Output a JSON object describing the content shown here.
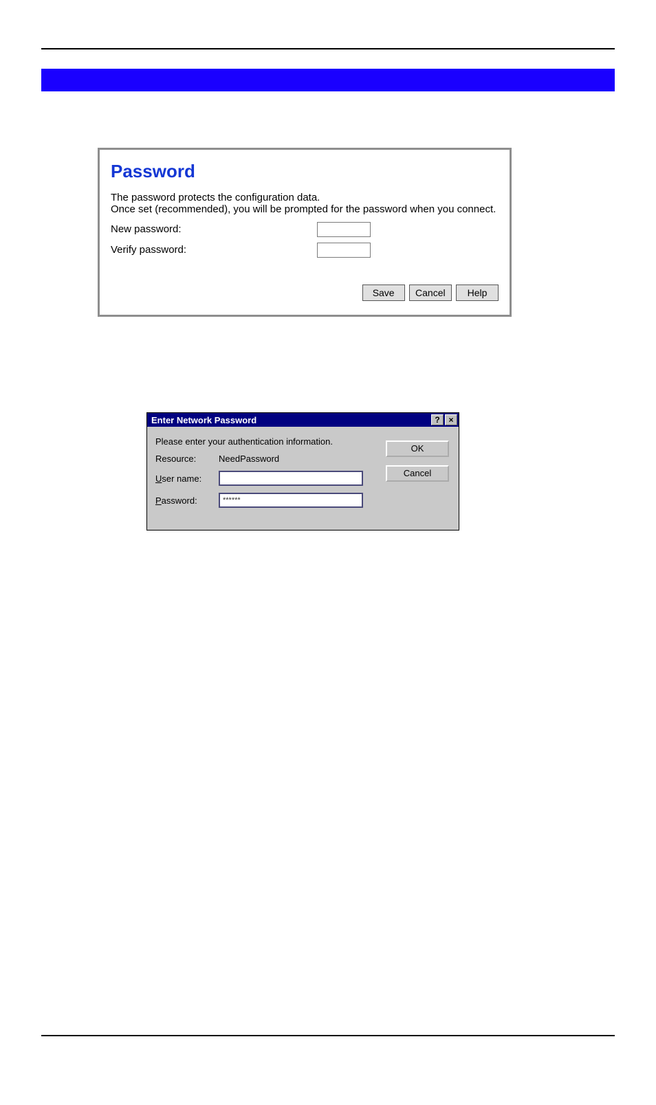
{
  "panel": {
    "title": "Password",
    "desc_line1": "The password protects the configuration data.",
    "desc_line2": "Once set (recommended), you will be prompted for the password when you connect.",
    "new_password_label": "New password:",
    "verify_password_label": "Verify password:",
    "new_password_value": "",
    "verify_password_value": "",
    "save_btn": "Save",
    "cancel_btn": "Cancel",
    "help_btn": "Help"
  },
  "dialog": {
    "title": "Enter Network Password",
    "help_glyph": "?",
    "close_glyph": "×",
    "prompt": "Please enter your authentication information.",
    "resource_label": "Resource:",
    "resource_value": "NeedPassword",
    "username_label_prefix": "U",
    "username_label_rest": "ser name:",
    "username_value": "",
    "password_label_prefix": "P",
    "password_label_rest": "assword:",
    "password_value": "******",
    "ok_btn": "OK",
    "cancel_btn": "Cancel"
  }
}
